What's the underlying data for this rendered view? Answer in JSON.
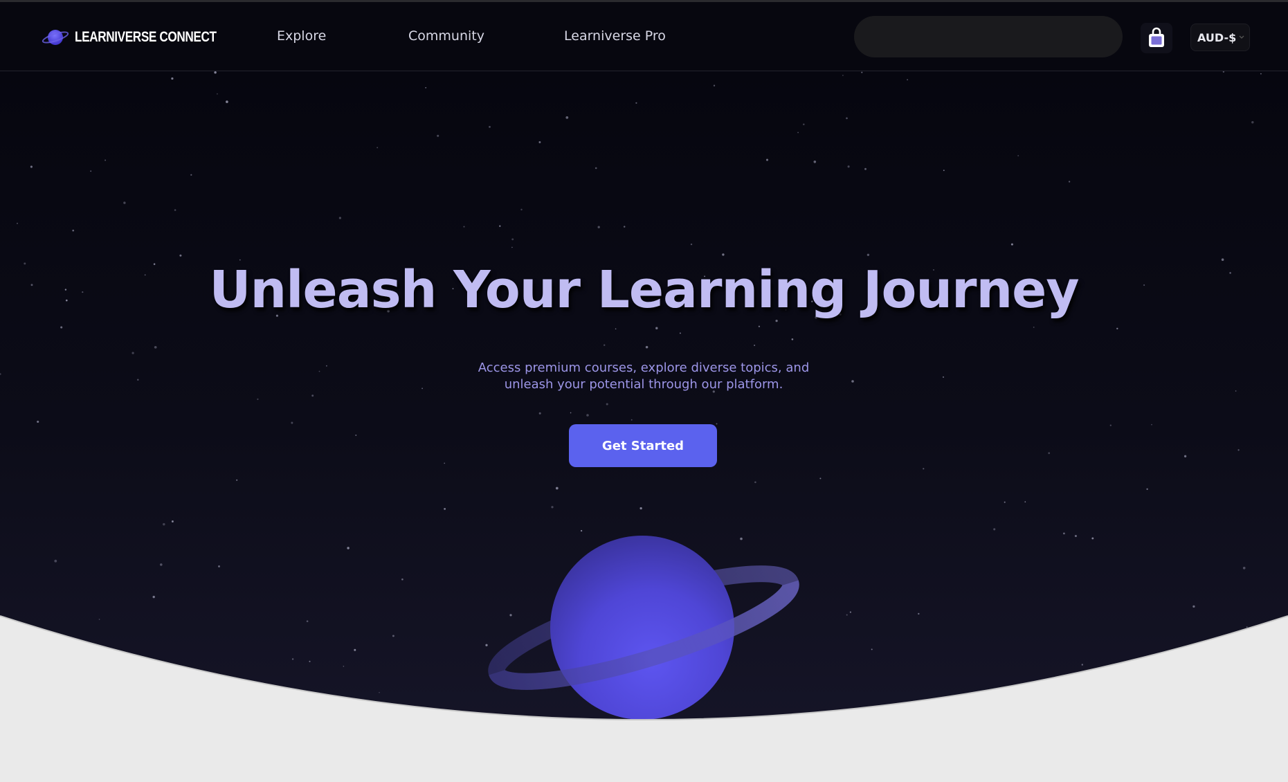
{
  "header": {
    "brand": "LEARNIVERSE CONNECT",
    "nav": [
      {
        "label": "Explore"
      },
      {
        "label": "Community"
      },
      {
        "label": "Learniverse Pro"
      }
    ],
    "search": {
      "value": "",
      "placeholder": ""
    },
    "cart_icon": "shopping-bag-icon",
    "currency": {
      "selected": "AUD-$"
    }
  },
  "hero": {
    "title": "Unleash Your Learning Journey",
    "subtitle": "Access premium courses, explore diverse topics, and unleash your potential through our platform.",
    "cta_label": "Get Started",
    "illustration_icon": "planet-icon"
  },
  "colors": {
    "background": "#07070f",
    "accent": "#5b62ee",
    "title": "#c0bcf2",
    "subtitle": "#9d96e8",
    "planet": "#5a50e6",
    "wave": "#eaeaea"
  }
}
